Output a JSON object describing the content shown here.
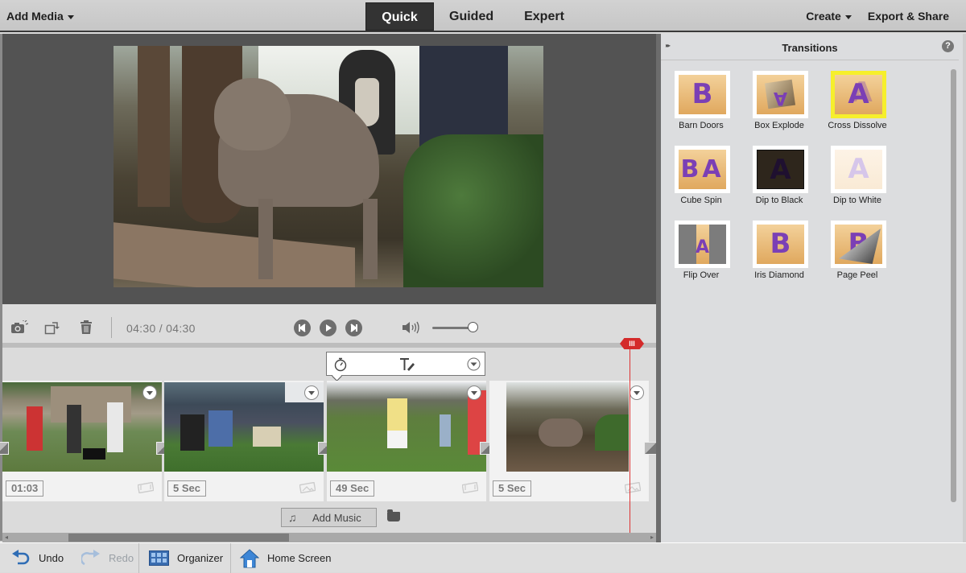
{
  "topbar": {
    "add_media_label": "Add Media",
    "modes": [
      {
        "label": "Quick",
        "active": true
      },
      {
        "label": "Guided",
        "active": false
      },
      {
        "label": "Expert",
        "active": false
      }
    ],
    "create_label": "Create",
    "export_label": "Export & Share"
  },
  "player": {
    "timecode_current": "04:30",
    "timecode_separator": "/",
    "timecode_total": "04:30",
    "volume_level_percent": 100
  },
  "timeline": {
    "clip_toolbar_icons": [
      "stopwatch-icon",
      "text-edit-icon",
      "dropdown-icon"
    ],
    "clips": [
      {
        "duration": "01:03",
        "type": "video"
      },
      {
        "duration": "5 Sec",
        "type": "image"
      },
      {
        "duration": "49 Sec",
        "type": "video"
      },
      {
        "duration": "5 Sec",
        "type": "image"
      }
    ],
    "playhead_label": "III",
    "add_music_label": "Add Music"
  },
  "panel": {
    "title": "Transitions",
    "help_glyph": "?",
    "collapse_glyph": "▸▸",
    "transitions": [
      {
        "label": "Barn Doors",
        "glyph": "B",
        "selected": false
      },
      {
        "label": "Box Explode",
        "glyph": "A",
        "selected": false
      },
      {
        "label": "Cross Dissolve",
        "glyph": "A",
        "selected": true
      },
      {
        "label": "Cube Spin",
        "glyph": "BA",
        "selected": false
      },
      {
        "label": "Dip to Black",
        "glyph": "A",
        "selected": false
      },
      {
        "label": "Dip to White",
        "glyph": "A",
        "selected": false
      },
      {
        "label": "Flip Over",
        "glyph": "A",
        "selected": false
      },
      {
        "label": "Iris Diamond",
        "glyph": "B",
        "selected": false
      },
      {
        "label": "Page Peel",
        "glyph": "B",
        "selected": false
      }
    ]
  },
  "bottombar": {
    "undo_label": "Undo",
    "redo_label": "Redo",
    "organizer_label": "Organizer",
    "home_label": "Home Screen"
  },
  "colors": {
    "accent_playhead": "#d42a2a",
    "selected_tile": "#f6ef2c",
    "transition_purple": "#7b3fb5"
  }
}
